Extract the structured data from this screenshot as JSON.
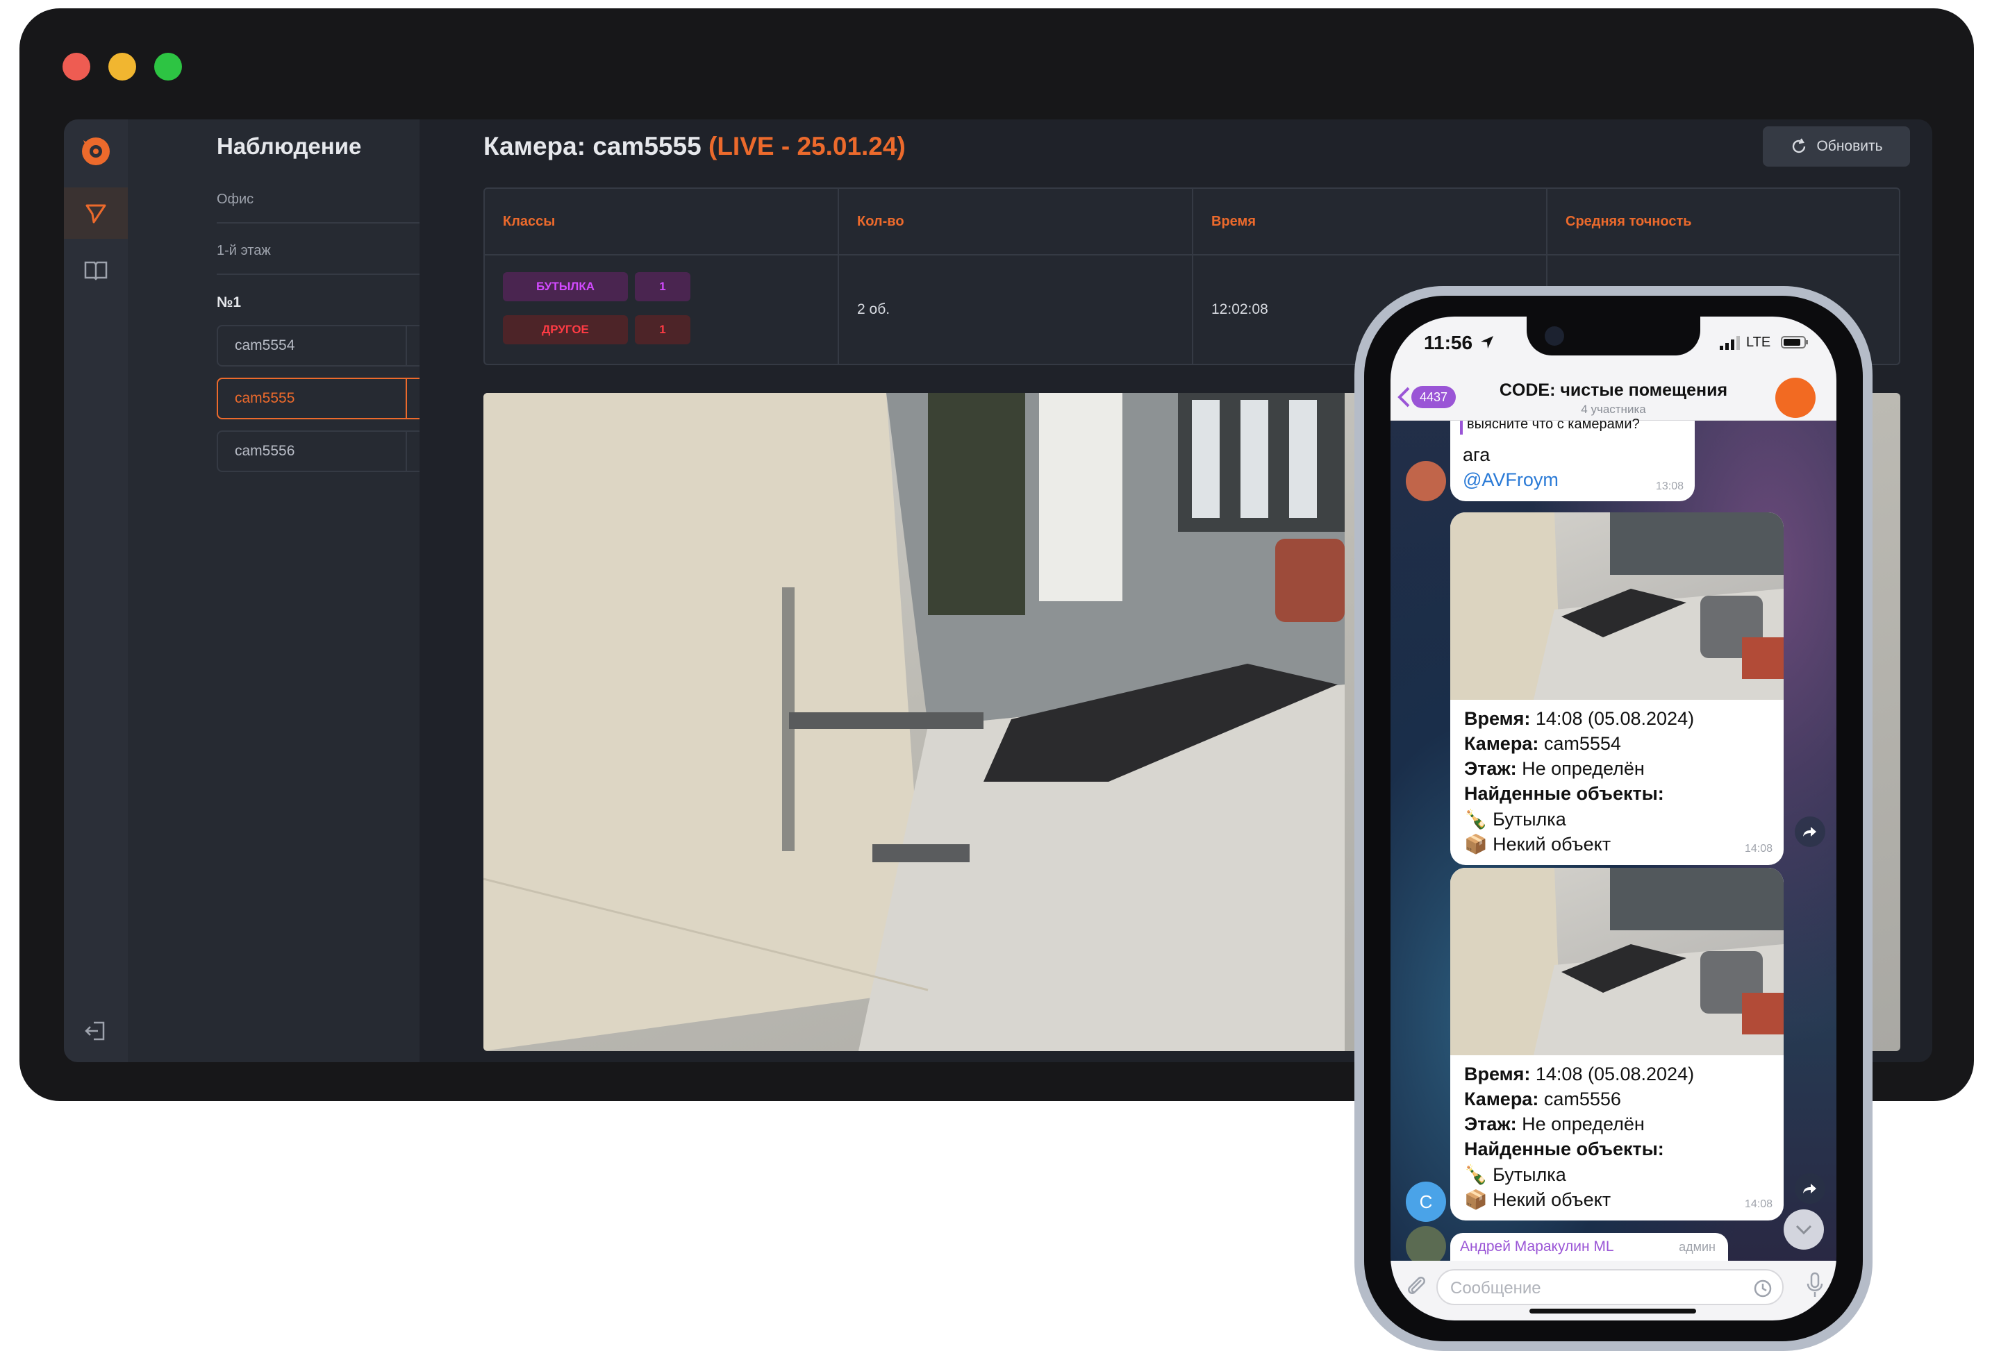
{
  "desktop": {
    "window_dots": [
      "#ee5c52",
      "#f1b630",
      "#2dc443"
    ],
    "colors": {
      "accent": "#ec6a2c",
      "panel": "#262a32",
      "bg": "#1f2229"
    },
    "sidebar": {
      "title": "Наблюдение",
      "section1": "Офис",
      "section2": "1-й этаж",
      "group_label": "№1",
      "cameras": [
        {
          "name": "cam5554",
          "active": false
        },
        {
          "name": "cam5555",
          "active": true
        },
        {
          "name": "cam5556",
          "active": false
        }
      ]
    },
    "header": {
      "title_prefix": "Камера: cam5555",
      "title_live": "(LIVE - 25.01.24)",
      "refresh_label": "Обновить"
    },
    "table": {
      "columns": [
        "Классы",
        "Кол-во",
        "Время",
        "Средняя точность"
      ],
      "row": {
        "tags": [
          {
            "label": "БУТЫЛКА",
            "count": "1",
            "color": "#c33be0"
          },
          {
            "label": "ДРУГОЕ",
            "count": "1",
            "color": "#e0323c"
          }
        ],
        "quantity": "2 об.",
        "time": "12:02:08"
      }
    }
  },
  "phone": {
    "status_time": "11:56",
    "status_network": "LTE",
    "back_badge": "4437",
    "chat_title": "CODE: чистые помещения",
    "chat_subtitle": "4 участника",
    "top_cut_text": "выясните что с камерами?",
    "msg_text": "ага",
    "msg_mention": "@AVFroym",
    "msg_time": "13:08",
    "cards": [
      {
        "time_label": "Время:",
        "time_value": "14:08 (05.08.2024)",
        "camera_label": "Камера:",
        "camera_value": "cam5554",
        "floor_label": "Этаж:",
        "floor_value": "Не определён",
        "objects_label": "Найденные объекты:",
        "objects": [
          "Бутылка",
          "Некий объект"
        ],
        "timestamp": "14:08"
      },
      {
        "time_label": "Время:",
        "time_value": "14:08 (05.08.2024)",
        "camera_label": "Камера:",
        "camera_value": "cam5556",
        "floor_label": "Этаж:",
        "floor_value": "Не определён",
        "objects_label": "Найденные объекты:",
        "objects": [
          "Бутылка",
          "Некий объект"
        ],
        "timestamp": "14:08"
      }
    ],
    "avatar_letter": "C",
    "last_sender": "Андрей Маракулин ML",
    "last_sender_role": "админ",
    "input_placeholder": "Сообщение"
  }
}
